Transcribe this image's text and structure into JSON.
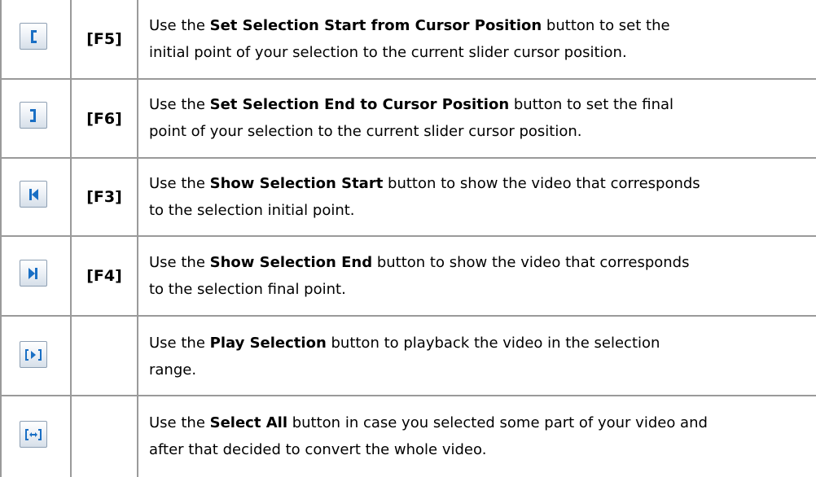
{
  "rows": [
    {
      "icon": "selection-start-bracket-icon",
      "key": "[F5]",
      "line1_pre": "Use the ",
      "line1_bold": "Set Selection Start from Cursor Position",
      "line1_post": " button to set the",
      "line2": "initial point of your selection to the current slider cursor position."
    },
    {
      "icon": "selection-end-bracket-icon",
      "key": "[F6]",
      "line1_pre": "Use the ",
      "line1_bold": "Set Selection End to Cursor Position",
      "line1_post": " button to set the final",
      "line2": "point of your selection to the current slider cursor position."
    },
    {
      "icon": "show-selection-start-icon",
      "key": "[F3]",
      "line1_pre": "Use the ",
      "line1_bold": "Show Selection Start",
      "line1_post": " button to show the video that corresponds",
      "line2": "to the selection initial point."
    },
    {
      "icon": "show-selection-end-icon",
      "key": "[F4]",
      "line1_pre": "Use the ",
      "line1_bold": "Show Selection End",
      "line1_post": " button to show the video that corresponds",
      "line2": "to the selection final point."
    },
    {
      "icon": "play-selection-icon",
      "key": "",
      "line1_pre": "Use the ",
      "line1_bold": "Play Selection",
      "line1_post": " button to playback the video in the selection",
      "line2": "range."
    },
    {
      "icon": "select-all-icon",
      "key": "",
      "line1_pre": "Use the ",
      "line1_bold": "Select All",
      "line1_post": " button in case you selected some part of your video and",
      "line2": "after that decided to convert the whole video."
    }
  ]
}
